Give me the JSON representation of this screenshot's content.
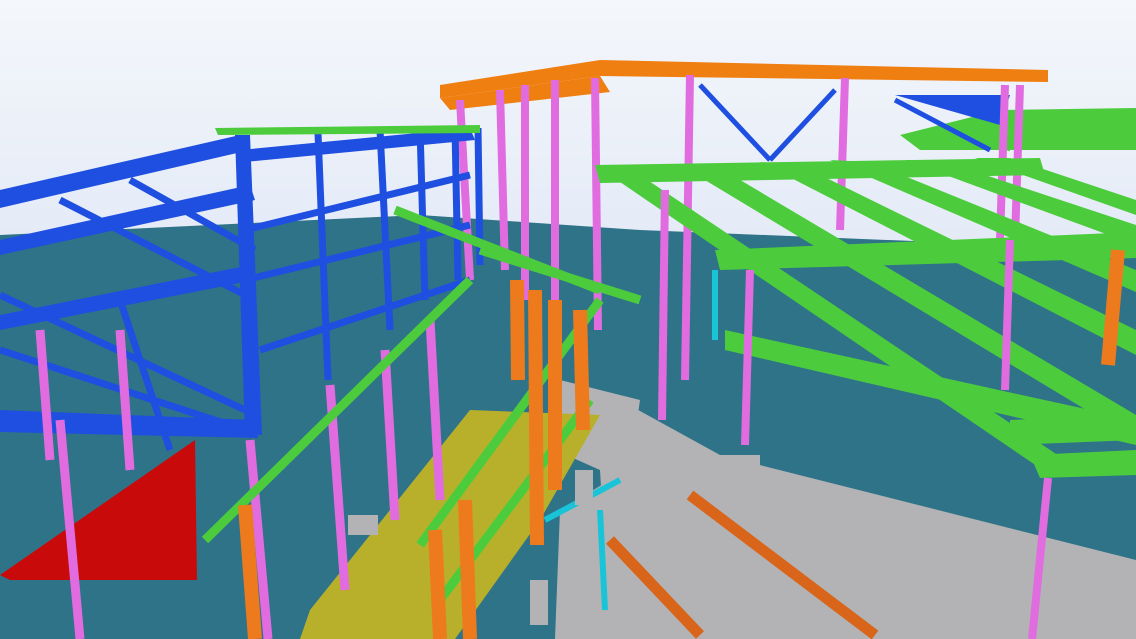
{
  "viewer": {
    "palette": {
      "sky_top": "#f4f7fb",
      "sky_bottom": "#c9d6f0",
      "floor": "#2f7388",
      "concrete": "#b3b3b5",
      "roof_truss": "#1f4fe0",
      "purlin_green": "#4ccc3c",
      "column_magenta": "#e06ce0",
      "column_orange": "#ee7a1e",
      "roof_orange": "#f07f12",
      "slab_yellow": "#b8b02a",
      "wall_red": "#c80a0a",
      "beam_orange": "#d9651a",
      "cyan_member": "#19c4d8"
    }
  }
}
